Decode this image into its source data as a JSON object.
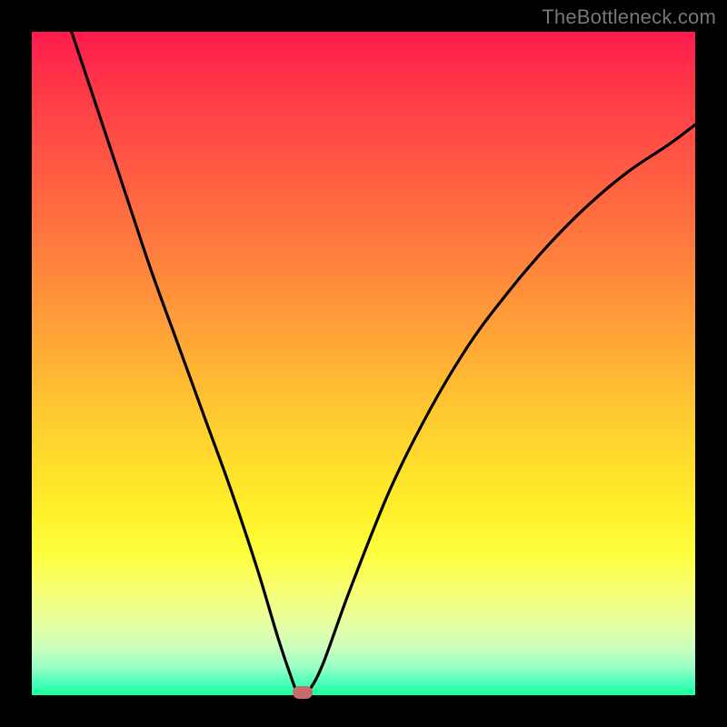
{
  "watermark": "TheBottleneck.com",
  "colors": {
    "background": "#000000",
    "curve": "#000000",
    "marker": "#c96b6b",
    "gradient_top": "#ff1a4d",
    "gradient_bottom": "#1aff9f"
  },
  "marker": {
    "x_pct": 40.8,
    "y_pct": 99.6
  },
  "chart_data": {
    "type": "line",
    "title": "",
    "xlabel": "",
    "ylabel": "",
    "xlim": [
      0,
      100
    ],
    "ylim": [
      0,
      100
    ],
    "note": "V-shaped bottleneck curve; minimum near x≈40 (y≈0). y represents bottleneck percentage (red=high, green=low).",
    "series": [
      {
        "name": "bottleneck-curve",
        "x": [
          6,
          10,
          14,
          18,
          22,
          26,
          30,
          34,
          37,
          39,
          40,
          41,
          42,
          44,
          48,
          54,
          60,
          66,
          72,
          78,
          84,
          90,
          96,
          100
        ],
        "y": [
          100,
          88,
          76,
          64,
          53,
          42,
          31,
          19,
          9,
          3,
          0.5,
          0.4,
          1,
          5,
          16,
          31,
          43,
          53,
          61,
          68,
          74,
          79,
          83,
          86
        ]
      }
    ],
    "marker_point": {
      "x": 40.8,
      "y": 0.4
    }
  }
}
